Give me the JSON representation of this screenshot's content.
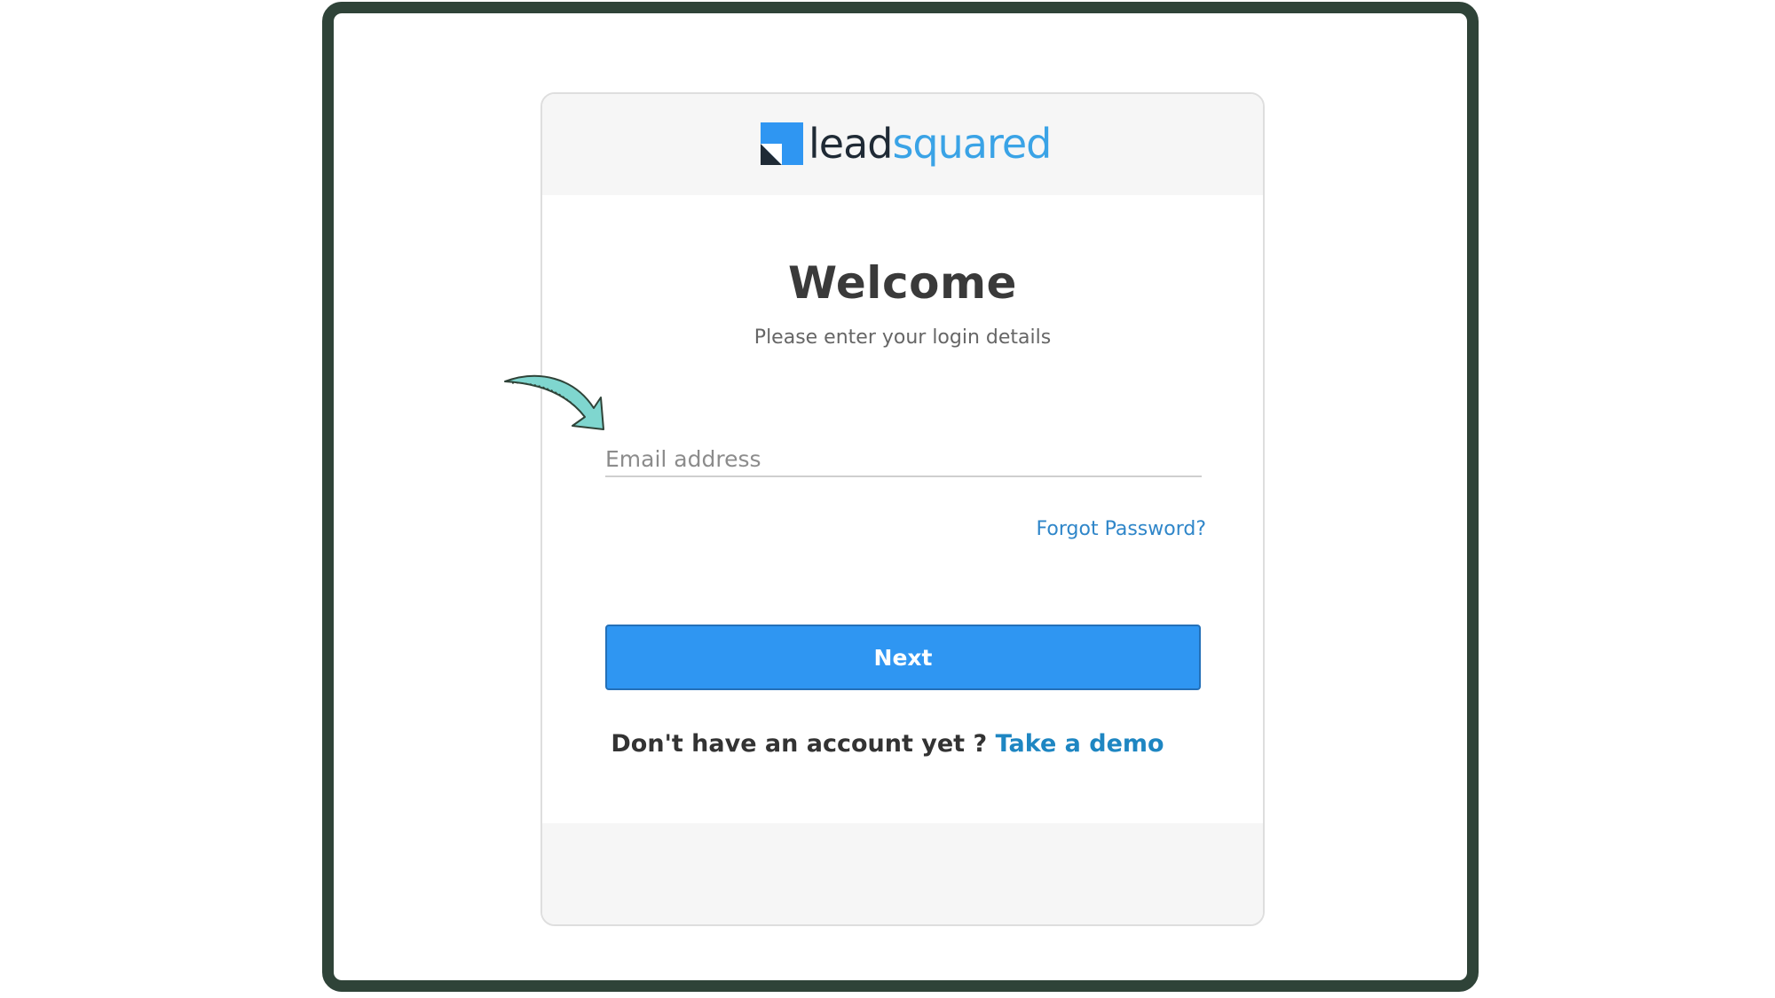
{
  "brand": {
    "name_part1": "lead",
    "name_part2": "squared",
    "logo_icon": "leadsquared-logo-icon",
    "primary_color": "#2f96f2",
    "link_color": "#1e86c2",
    "frame_color": "#2f4338"
  },
  "login": {
    "title": "Welcome",
    "subtitle": "Please enter your login details",
    "email_placeholder": "Email address",
    "email_value": "",
    "forgot_password_label": "Forgot Password?",
    "next_button_label": "Next",
    "signup_prompt": "Don't have an account yet ? ",
    "signup_link_label": "Take a demo"
  },
  "annotation": {
    "arrow_icon": "curved-arrow-icon",
    "arrow_color": "#7fd6cf"
  }
}
